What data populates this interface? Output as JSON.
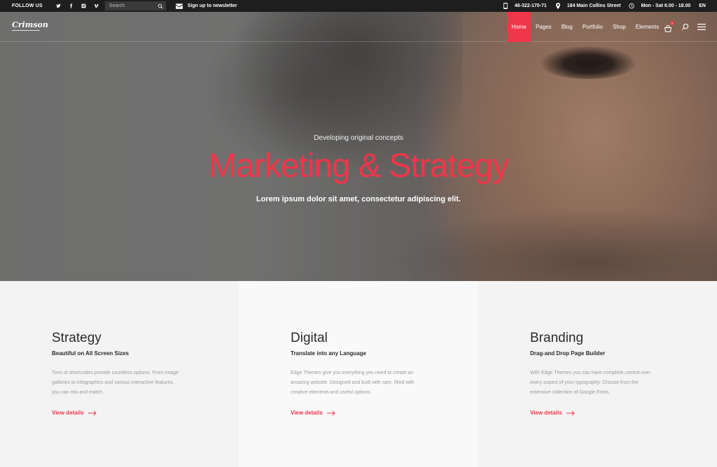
{
  "topbar": {
    "follow_label": "FOLLOW US",
    "social_icons": [
      "twitter-icon",
      "facebook-icon",
      "instagram-icon",
      "vimeo-icon"
    ],
    "search_placeholder": "Search",
    "newsletter_label": "Sign up to newsletter",
    "phone": "46-322-170-71",
    "address": "184 Main Collins Street",
    "hours": "Mon - Sat 8.00 - 18.00",
    "language": "EN"
  },
  "nav": {
    "logo": "Crimson",
    "items": [
      "Home",
      "Pages",
      "Blog",
      "Portfolio",
      "Shop",
      "Elements"
    ],
    "active_item": "Home",
    "cart_count": "0"
  },
  "hero": {
    "kicker": "Developing original concepts",
    "headline": "Marketing & Strategy",
    "subline": "Lorem ipsum dolor sit amet, consectetur adipiscing elit."
  },
  "features": [
    {
      "title": "Strategy",
      "subtitle": "Beautiful on All Screen Sizes",
      "text_lines": [
        "Tons of shortcodes provide countless options. From image",
        "galleries to infographics and various interactive features,",
        "you can mix and match."
      ],
      "link": "View details"
    },
    {
      "title": "Digital",
      "subtitle": "Translate into any Language",
      "text_lines": [
        "Edge Themes give you everything you need to create an",
        "amazing website.  Designed and built with care, filled with",
        "creative elements and useful options."
      ],
      "link": "View details"
    },
    {
      "title": "Branding",
      "subtitle": "Drag-and Drop Page Builder",
      "text_lines": [
        "With Edge Themes you can have complete control over",
        "every aspect of your typography. Choose from the",
        "extensive collection of Google Fonts."
      ],
      "link": "View details"
    }
  ],
  "colors": {
    "accent": "#f0364a",
    "topbar_bg": "#1e1e1e",
    "text_dark": "#2b2b2b",
    "text_muted": "#9a9a9a"
  }
}
